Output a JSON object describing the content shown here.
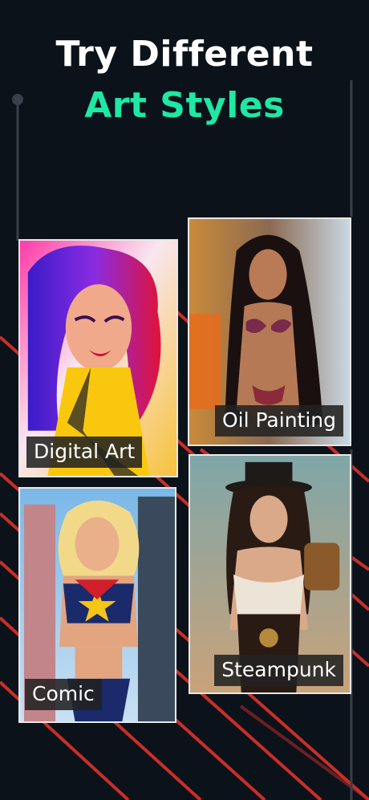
{
  "headline": {
    "line1": "Try Different",
    "line2": "Art Styles"
  },
  "styles": [
    {
      "label": "Digital Art"
    },
    {
      "label": "Oil Painting"
    },
    {
      "label": "Comic"
    },
    {
      "label": "Steampunk"
    }
  ],
  "colors": {
    "background": "#0b121a",
    "accent_green": "#1ee8a4",
    "accent_red": "#e0322a",
    "label_bg": "#222222",
    "card_border": "#e8e8e8"
  }
}
